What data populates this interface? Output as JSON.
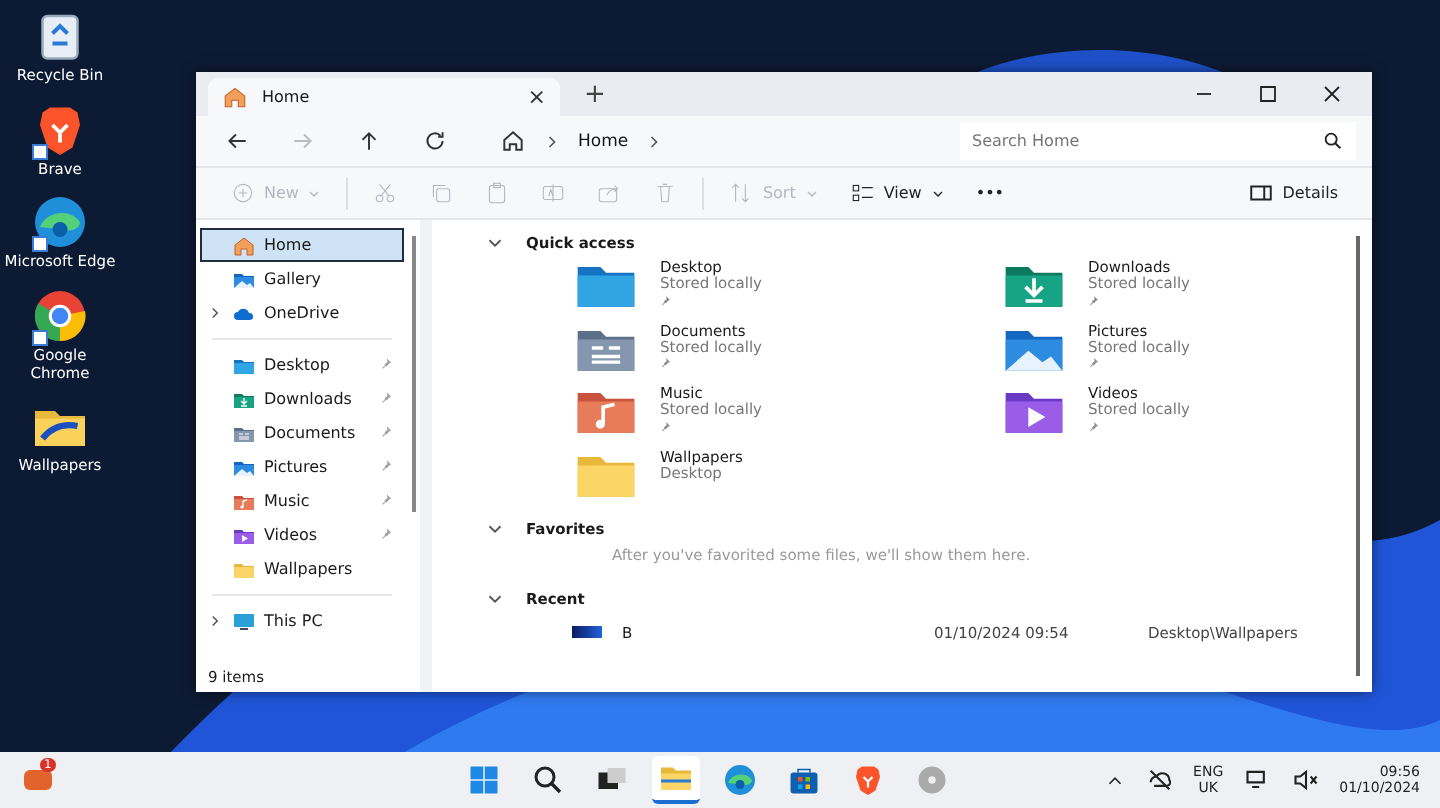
{
  "desktop_icons": [
    {
      "label": "Recycle Bin",
      "kind": "recycle",
      "shortcut": false
    },
    {
      "label": "Brave",
      "kind": "brave",
      "shortcut": true
    },
    {
      "label": "Microsoft Edge",
      "kind": "edge",
      "shortcut": true
    },
    {
      "label": "Google Chrome",
      "kind": "chrome",
      "shortcut": true
    },
    {
      "label": "Wallpapers",
      "kind": "wallfolder",
      "shortcut": false
    }
  ],
  "window": {
    "tab": {
      "title": "Home",
      "close": "×"
    },
    "new_tab": "+",
    "address": {
      "crumbs": [
        "Home"
      ]
    },
    "search": {
      "placeholder": "Search Home"
    },
    "toolbar": [
      {
        "kind": "new",
        "label": "New",
        "disabled": true
      },
      {
        "kind": "cut",
        "disabled": true
      },
      {
        "kind": "copy",
        "disabled": true
      },
      {
        "kind": "paste",
        "disabled": true
      },
      {
        "kind": "rename",
        "disabled": true
      },
      {
        "kind": "share",
        "disabled": true
      },
      {
        "kind": "delete",
        "disabled": true
      },
      {
        "kind": "sort",
        "label": "Sort",
        "disabled": true
      },
      {
        "kind": "view",
        "label": "View",
        "disabled": false
      },
      {
        "kind": "more",
        "label": "•••",
        "disabled": false
      }
    ],
    "details": "Details",
    "sidebar": [
      [
        {
          "label": "Home",
          "kind": "home",
          "selected": true,
          "pinned": false,
          "expandable": false
        },
        {
          "label": "Gallery",
          "kind": "pictures",
          "selected": false,
          "pinned": false,
          "expandable": false
        },
        {
          "label": "OneDrive",
          "kind": "cloud",
          "selected": false,
          "pinned": false,
          "expandable": true
        }
      ],
      [
        {
          "label": "Desktop",
          "kind": "desktop",
          "selected": false,
          "pinned": true,
          "expandable": false
        },
        {
          "label": "Downloads",
          "kind": "download",
          "selected": false,
          "pinned": true,
          "expandable": false
        },
        {
          "label": "Documents",
          "kind": "documents",
          "selected": false,
          "pinned": true,
          "expandable": false
        },
        {
          "label": "Pictures",
          "kind": "pictures",
          "selected": false,
          "pinned": true,
          "expandable": false
        },
        {
          "label": "Music",
          "kind": "music",
          "selected": false,
          "pinned": true,
          "expandable": false
        },
        {
          "label": "Videos",
          "kind": "videos",
          "selected": false,
          "pinned": true,
          "expandable": false
        },
        {
          "label": "Wallpapers",
          "kind": "folder",
          "selected": false,
          "pinned": false,
          "expandable": false
        }
      ],
      [
        {
          "label": "This PC",
          "kind": "pc",
          "selected": false,
          "pinned": false,
          "expandable": true
        }
      ]
    ],
    "quick_access": {
      "title": "Quick access",
      "expanded": true,
      "items": [
        {
          "name": "Desktop",
          "detail": "Stored locally",
          "kind": "desktop",
          "pinned": true
        },
        {
          "name": "Downloads",
          "detail": "Stored locally",
          "kind": "download",
          "pinned": true
        },
        {
          "name": "Documents",
          "detail": "Stored locally",
          "kind": "documents",
          "pinned": true
        },
        {
          "name": "Pictures",
          "detail": "Stored locally",
          "kind": "pictures",
          "pinned": true
        },
        {
          "name": "Music",
          "detail": "Stored locally",
          "kind": "music",
          "pinned": true
        },
        {
          "name": "Videos",
          "detail": "Stored locally",
          "kind": "videos",
          "pinned": true
        },
        {
          "name": "Wallpapers",
          "detail": "Desktop",
          "kind": "folder",
          "pinned": false
        }
      ]
    },
    "favorites": {
      "title": "Favorites",
      "expanded": true,
      "message": "After you've favorited some files, we'll show them here."
    },
    "recent": {
      "title": "Recent",
      "expanded": true,
      "rows": [
        {
          "name": "B",
          "date": "01/10/2024 09:54",
          "location": "Desktop\\Wallpapers"
        }
      ]
    },
    "status": "9 items"
  },
  "taskbar": {
    "widget_badge": "1",
    "apps": [
      {
        "kind": "start",
        "selected": false
      },
      {
        "kind": "search",
        "selected": false
      },
      {
        "kind": "taskview",
        "selected": false
      },
      {
        "kind": "explorer",
        "selected": true
      },
      {
        "kind": "edge",
        "selected": false
      },
      {
        "kind": "store",
        "selected": false
      },
      {
        "kind": "brave",
        "selected": false
      },
      {
        "kind": "disc",
        "selected": false
      }
    ],
    "language": [
      "ENG",
      "UK"
    ],
    "time": "09:56",
    "date": "01/10/2024"
  }
}
